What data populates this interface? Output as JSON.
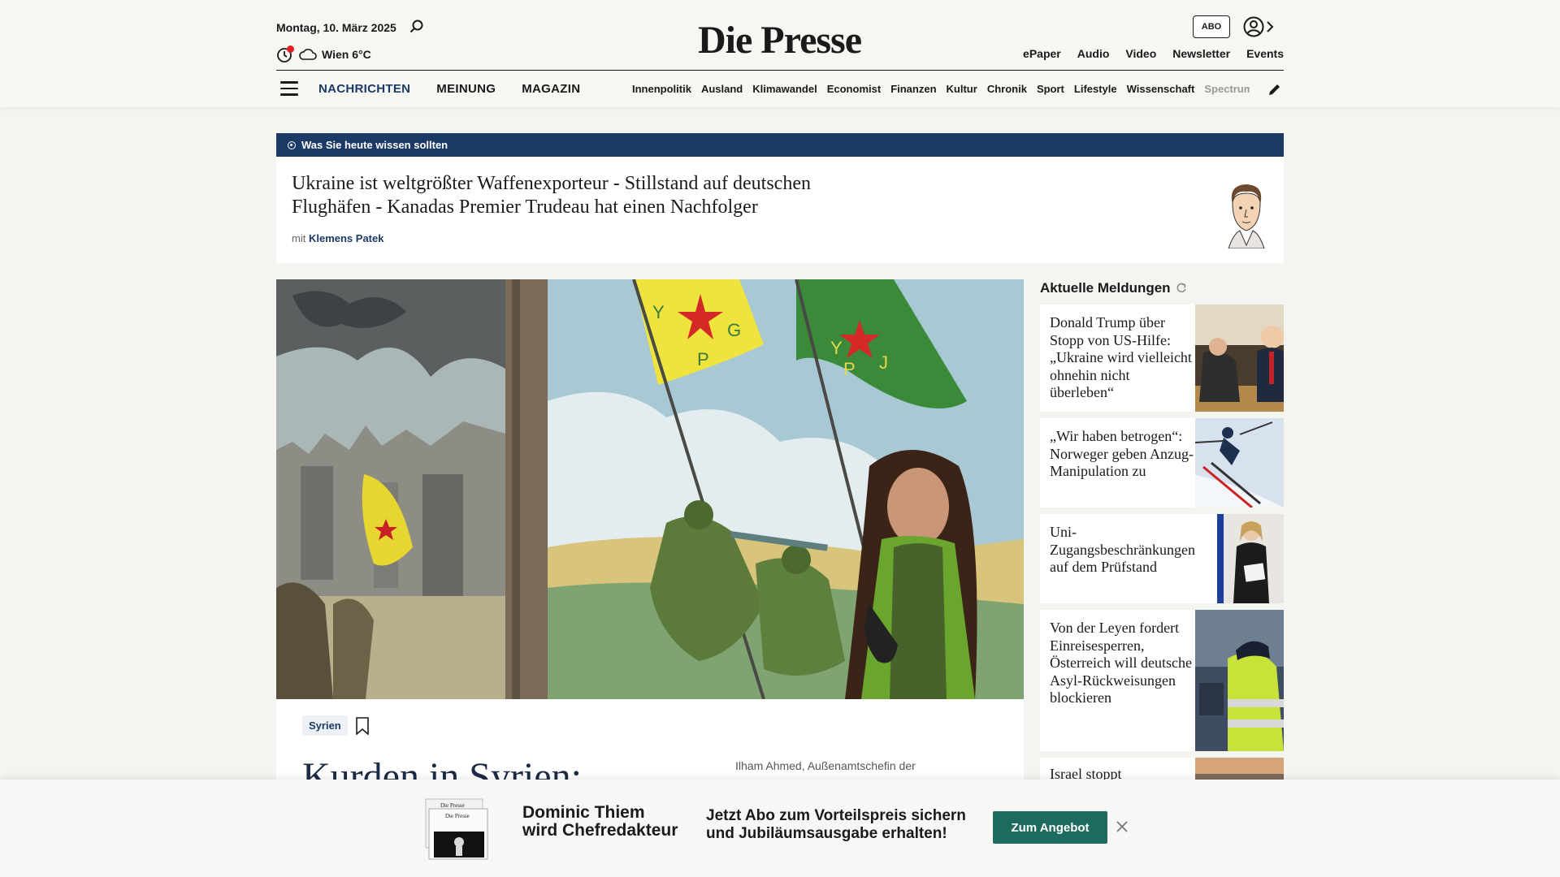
{
  "header": {
    "date": "Montag, 10. März 2025",
    "weather": "Wien 6°C",
    "logo": "Die Presse",
    "abo_label": "ABO",
    "top_links": [
      "ePaper",
      "Audio",
      "Video",
      "Newsletter",
      "Events"
    ],
    "main_nav": [
      "NACHRICHTEN",
      "MEINUNG",
      "MAGAZIN"
    ],
    "sub_nav": [
      "Innenpolitik",
      "Ausland",
      "Klimawandel",
      "Economist",
      "Finanzen",
      "Kultur",
      "Chronik",
      "Sport",
      "Lifestyle",
      "Wissenschaft",
      "Spectrum"
    ]
  },
  "briefing": {
    "label": "Was Sie heute wissen sollten",
    "title": "Ukraine ist weltgrößter Waffenexporteur - Stillstand auf deutschen Flughäfen - Kanadas Premier Trudeau hat einen Nachfolger",
    "author_prefix": "mit",
    "author_name": "Klemens Patek"
  },
  "hero": {
    "tag": "Syrien",
    "title": "Kurden in Syrien:",
    "caption": "Ilham Ahmed, Außenamtschefin der",
    "flag1_letters": [
      "Y",
      "P",
      "G"
    ],
    "flag2_letters": [
      "Y",
      "P",
      "J"
    ]
  },
  "sidebar": {
    "title": "Aktuelle Meldungen",
    "items": [
      {
        "text": "Donald Trump über Stopp von US-Hilfe: „Ukraine wird vielleicht ohnehin nicht überleben“"
      },
      {
        "text": "„Wir haben betrogen“: Norweger geben Anzug-Manipulation zu"
      },
      {
        "text": "Uni-Zugangsbeschränkungen auf dem Prüfstand"
      },
      {
        "text": "Von der Leyen fordert Einreisesperren, Österreich will deutsche Asyl-Rückweisungen blockieren"
      },
      {
        "text": "Israel stoppt"
      }
    ]
  },
  "promo": {
    "paper_logo": "Die Presse",
    "name_line1": "Dominic Thiem",
    "name_line2": "wird Chefredakteur",
    "text_line1": "Jetzt Abo zum Vorteilspreis sichern",
    "text_line2": "und Jubiläumsausgabe erhalten!",
    "button": "Zum Angebot"
  },
  "colors": {
    "navy": "#1c3a66",
    "button_green": "#1d6a5e",
    "alert_red": "#e02020"
  }
}
